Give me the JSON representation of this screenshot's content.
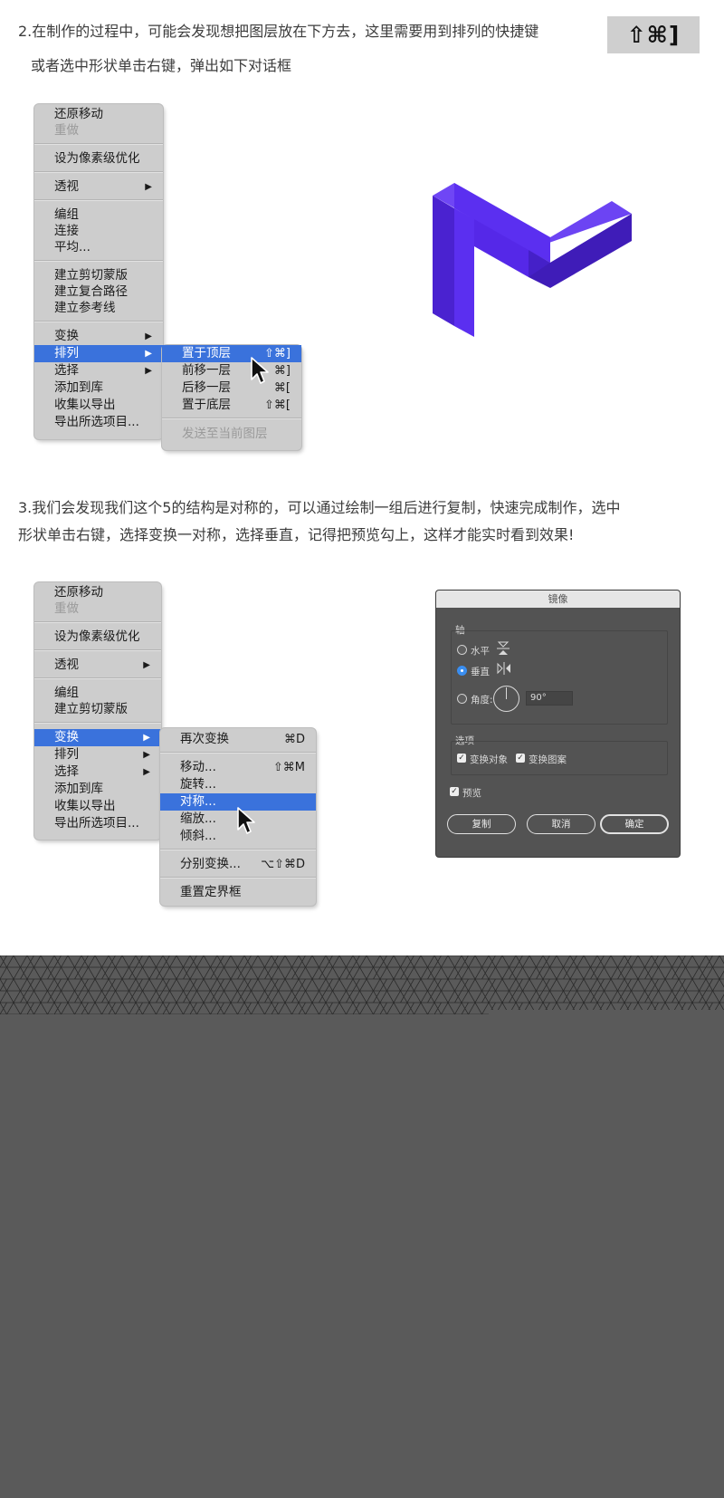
{
  "section2": {
    "line1": "2.在制作的过程中，可能会发现想把图层放在下方去，这里需要用到排列的快捷键",
    "line2": "或者选中形状单击右键，弹出如下对话框",
    "shortcut": "⇧⌘]"
  },
  "menu1": {
    "items": [
      "还原移动",
      "重做",
      "设为像素级优化",
      "透视",
      "编组",
      "连接",
      "平均...",
      "建立剪切蒙版",
      "建立复合路径",
      "建立参考线",
      "变换",
      "排列",
      "选择",
      "添加到库",
      "收集以导出",
      "导出所选项目..."
    ],
    "arrow": "▶"
  },
  "submenu1": {
    "items": [
      "置于顶层",
      "前移一层",
      "后移一层",
      "置于底层",
      "发送至当前图层"
    ],
    "shortcuts": [
      "⇧⌘]",
      "⌘]",
      "⌘[",
      "⇧⌘["
    ]
  },
  "section3": {
    "line1": "3.我们会发现我们这个5的结构是对称的，可以通过绘制一组后进行复制，快速完成制作，选中",
    "line2": "形状单击右键，选择变换一对称，选择垂直，记得把预览勾上，这样才能实时看到效果!"
  },
  "menu2": {
    "items": [
      "还原移动",
      "重做",
      "设为像素级优化",
      "透视",
      "编组",
      "建立剪切蒙版",
      "变换",
      "排列",
      "选择",
      "添加到库",
      "收集以导出",
      "导出所选项目..."
    ],
    "arrow": "▶"
  },
  "submenu2": {
    "items": [
      "再次变换",
      "移动...",
      "旋转...",
      "对称...",
      "缩放...",
      "倾斜...",
      "分别变换...",
      "重置定界框"
    ],
    "shortcuts": [
      "⌘D",
      "⇧⌘M",
      "⌥⇧⌘D"
    ]
  },
  "dialog": {
    "title": "镜像",
    "axis_label": "轴",
    "horizontal": "水平",
    "vertical": "垂直",
    "angle_label": "角度:",
    "angle_value": "90°",
    "options_label": "选项",
    "transform_objects": "变换对象",
    "transform_patterns": "变换图案",
    "preview": "预览",
    "copy": "复制",
    "cancel": "取消",
    "ok": "确定",
    "check_mark": "✓"
  },
  "colors": {
    "logo_front": "#5b2ff0",
    "logo_side": "#4520c8",
    "logo_top": "#6f46f5",
    "menu_highlight": "#3a72dc",
    "dialog_bg": "#535353",
    "footer_bg": "#5a5a5a"
  }
}
